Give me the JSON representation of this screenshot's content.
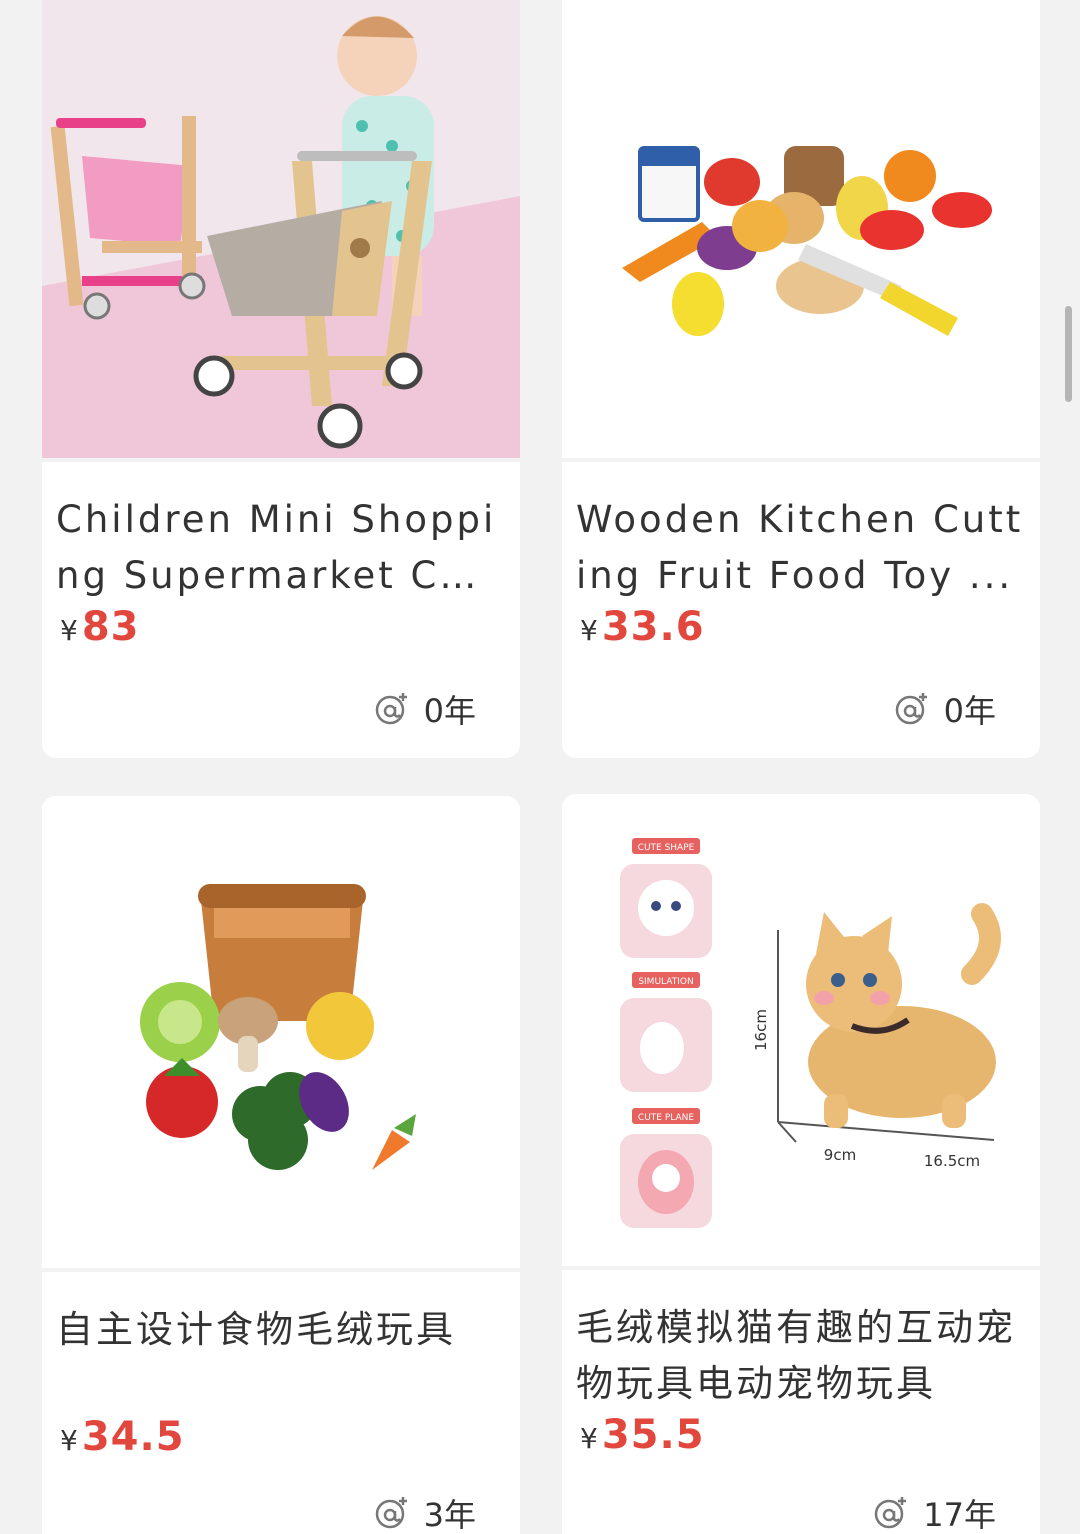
{
  "products": [
    {
      "title": "Children Mini Shopping Supermarket Ca...",
      "currency": "¥",
      "price": "83",
      "years": "0年",
      "image_icon": "shopping-cart-toy-image"
    },
    {
      "title": "Wooden Kitchen Cutting Fruit Food Toy ...",
      "currency": "¥",
      "price": "33.6",
      "years": "0年",
      "image_icon": "kitchen-food-toy-image"
    },
    {
      "title": "自主设计食物毛绒玩具",
      "currency": "¥",
      "price": "34.5",
      "years": "3年",
      "image_icon": "plush-food-basket-image"
    },
    {
      "title": "毛绒模拟猫有趣的互动宠物玩具电动宠物玩具",
      "currency": "¥",
      "price": "35.5",
      "years": "17年",
      "image_icon": "plush-cat-toy-image"
    }
  ],
  "image_labels": {
    "cute_shape": "CUTE SHAPE",
    "simulation": "SIMULATION",
    "cute_plane": "CUTE PLANE",
    "dim_height": "16cm",
    "dim_width": "9cm",
    "dim_length": "16.5cm"
  },
  "colors": {
    "price": "#e2473d",
    "background": "#f2f2f2",
    "card": "#ffffff"
  }
}
